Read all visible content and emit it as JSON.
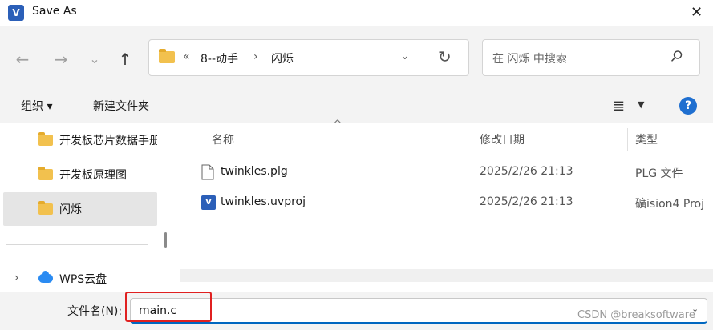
{
  "window": {
    "title": "Save As",
    "close_glyph": "✕",
    "app_icon_glyph": "V"
  },
  "nav": {
    "back_glyph": "←",
    "forward_glyph": "→",
    "recent_glyph": "⌄",
    "up_glyph": "↑"
  },
  "address": {
    "overflow": "«",
    "crumbs": [
      "8--动手",
      "闪烁"
    ],
    "separator": "›",
    "dropdown_glyph": "⌄",
    "refresh_glyph": "↻"
  },
  "search": {
    "placeholder": "在 闪烁 中搜索"
  },
  "toolbar": {
    "organize_label": "组织 ▾",
    "new_folder_label": "新建文件夹",
    "view_glyph": "≣",
    "view_caret": "▼",
    "help_glyph": "?"
  },
  "tree": {
    "items": [
      {
        "label": "开发板芯片数据手册",
        "selected": false
      },
      {
        "label": "开发板原理图",
        "selected": false
      },
      {
        "label": "闪烁",
        "selected": true
      }
    ],
    "expander_glyph": "›",
    "cloud_label": "WPS云盘"
  },
  "list": {
    "sort_glyph": "^",
    "columns": {
      "name": "名称",
      "date": "修改日期",
      "type": "类型"
    },
    "rows": [
      {
        "name": "twinkles.plg",
        "date": "2025/2/26 21:13",
        "type": "PLG 文件",
        "icon": "document-icon"
      },
      {
        "name": "twinkles.uvproj",
        "date": "2025/2/26 21:13",
        "type": "礦ision4 Proj",
        "icon": "uvision-project-icon"
      }
    ]
  },
  "filename": {
    "label": "文件名(N):",
    "value": "main.c",
    "dropdown_glyph": "⌄"
  },
  "watermark": "CSDN @breaksoftware",
  "colors": {
    "accent": "#0067c0",
    "highlight": "#e02020",
    "folder": "#f2c14e",
    "help": "#1f6fd0"
  }
}
